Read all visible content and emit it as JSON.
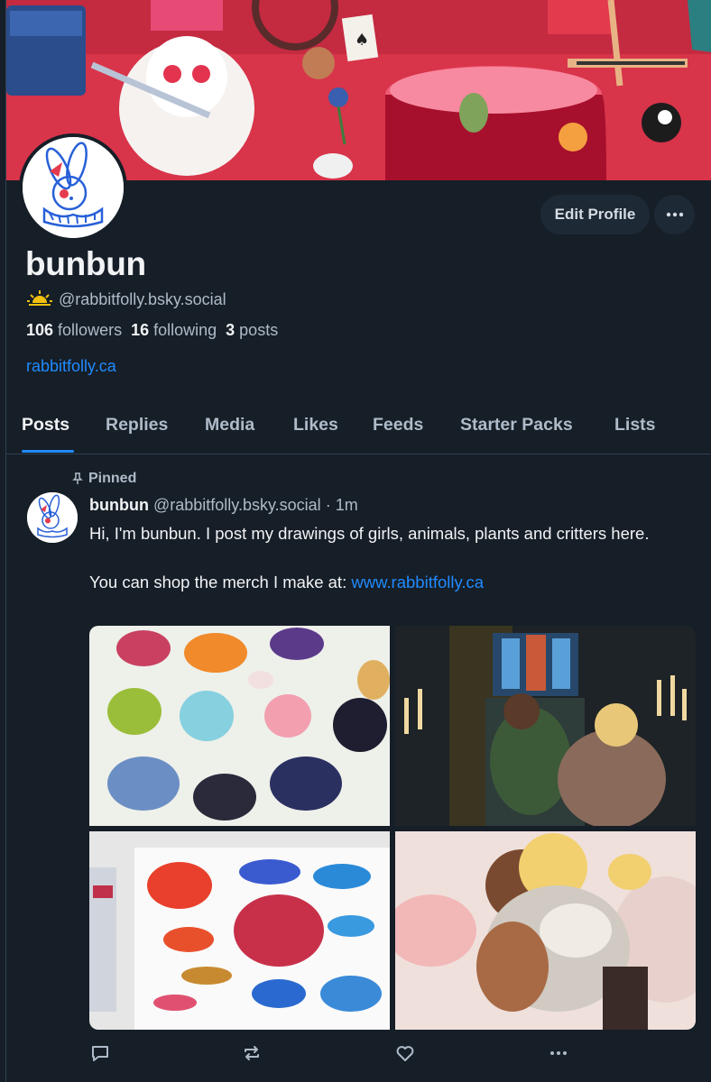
{
  "profile": {
    "display_name": "bunbun",
    "handle": "@rabbitfolly.bsky.social",
    "handle_icon": "sun-icon",
    "followers_count": "106",
    "followers_label": "followers",
    "following_count": "16",
    "following_label": "following",
    "posts_count": "3",
    "posts_label": "posts",
    "website": "rabbitfolly.ca",
    "edit_button": "Edit Profile",
    "more_icon": "ellipsis-icon"
  },
  "tabs": [
    {
      "label": "Posts",
      "active": true
    },
    {
      "label": "Replies"
    },
    {
      "label": "Media"
    },
    {
      "label": "Likes"
    },
    {
      "label": "Feeds"
    },
    {
      "label": "Starter Packs"
    },
    {
      "label": "Lists"
    }
  ],
  "post": {
    "pinned_label": "Pinned",
    "author": "bunbun",
    "handle": "@rabbitfolly.bsky.social",
    "separator": "·",
    "time": "1m",
    "text_line1": "Hi, I'm bunbun. I post my drawings of girls, animals, plants and critters here.",
    "text_line2": "You can shop the merch I make at: ",
    "link": "www.rabbitfolly.ca",
    "actions": [
      "reply-icon",
      "repost-icon",
      "like-icon",
      "more-icon"
    ]
  },
  "colors": {
    "background": "#161e27",
    "accent": "#208bfe",
    "muted": "#aebbc9"
  }
}
